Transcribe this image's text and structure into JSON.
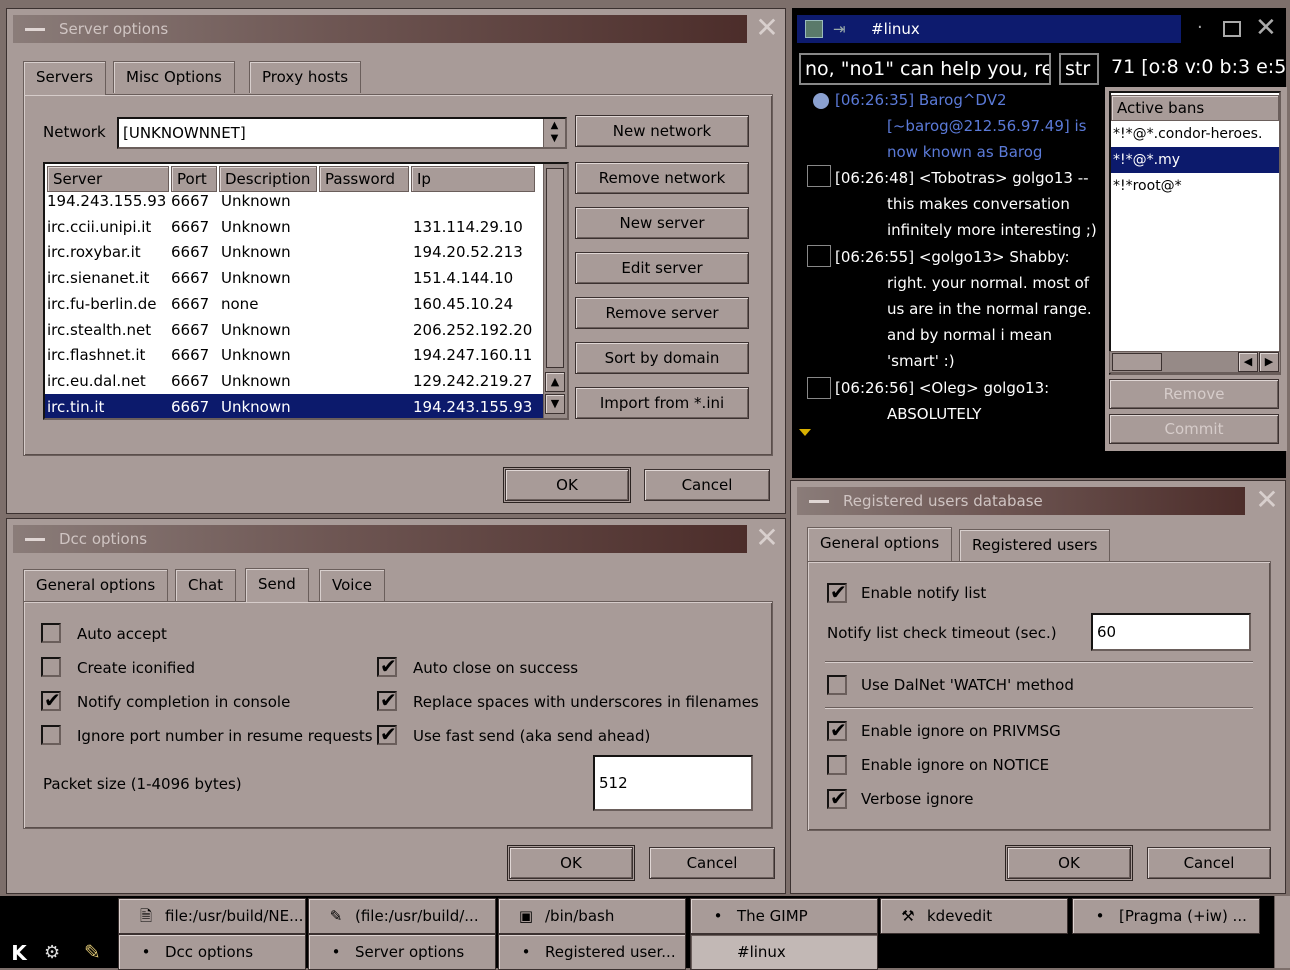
{
  "server_options": {
    "title": "Server options",
    "tabs": [
      "Servers",
      "Misc Options",
      "Proxy hosts"
    ],
    "network_label": "Network",
    "network_value": "[UNKNOWNNET]",
    "columns": [
      "Server",
      "Port",
      "Description",
      "Password",
      "Ip"
    ],
    "rows": [
      {
        "server": "194.243.155.93",
        "port": "6667",
        "desc": "Unknown",
        "ip": ""
      },
      {
        "server": "irc.ccii.unipi.it",
        "port": "6667",
        "desc": "Unknown",
        "ip": "131.114.29.10"
      },
      {
        "server": "irc.roxybar.it",
        "port": "6667",
        "desc": "Unknown",
        "ip": "194.20.52.213"
      },
      {
        "server": "irc.sienanet.it",
        "port": "6667",
        "desc": "Unknown",
        "ip": "151.4.144.10"
      },
      {
        "server": "irc.fu-berlin.de",
        "port": "6667",
        "desc": "none",
        "ip": "160.45.10.24"
      },
      {
        "server": "irc.stealth.net",
        "port": "6667",
        "desc": "Unknown",
        "ip": "206.252.192.20"
      },
      {
        "server": "irc.flashnet.it",
        "port": "6667",
        "desc": "Unknown",
        "ip": "194.247.160.11"
      },
      {
        "server": "irc.eu.dal.net",
        "port": "6667",
        "desc": "Unknown",
        "ip": "129.242.219.27"
      },
      {
        "server": "irc.tin.it",
        "port": "6667",
        "desc": "Unknown",
        "ip": "194.243.155.93"
      }
    ],
    "buttons": [
      "New network",
      "Remove network",
      "New server",
      "Edit server",
      "Remove server",
      "Sort by domain",
      "Import from *.ini"
    ],
    "ok": "OK",
    "cancel": "Cancel"
  },
  "irc": {
    "title": "#linux",
    "topic": "no, \"no1\" can help you, re",
    "topic2": "str",
    "modes": "71 [o:8 v:0 b:3 e:5",
    "messages": [
      {
        "l1": "[06:26:35] Barog^DV2",
        "l2": "[~barog@212.56.97.49] is",
        "l3": "now known as Barog"
      },
      {
        "l1": "[06:26:48] <Tobotras> golgo13 --",
        "l2": "this makes conversation",
        "l3": "infinitely more interesting ;)"
      },
      {
        "l1": "[06:26:55] <golgo13> Shabby:",
        "l2": "right. your normal. most of",
        "l3": "us are in the normal range.",
        "l4": "and by normal i mean",
        "l5": "'smart' :)"
      },
      {
        "l1": "[06:26:56] <Oleg> golgo13:",
        "l2": "ABSOLUTELY"
      }
    ],
    "bans_header": "Active bans",
    "bans": [
      "*!*@*.condor-heroes.",
      "*!*@*.my",
      "*!*root@*"
    ],
    "remove": "Remove",
    "commit": "Commit"
  },
  "dcc": {
    "title": "Dcc options",
    "tabs": [
      "General options",
      "Chat",
      "Send",
      "Voice"
    ],
    "auto_accept": "Auto accept",
    "create_iconified": "Create iconified",
    "notify_completion": "Notify completion in console",
    "ignore_port": "Ignore port number in resume requests",
    "auto_close": "Auto close on success",
    "replace_spaces": "Replace spaces with underscores in filenames",
    "fast_send": "Use fast send (aka send ahead)",
    "packet_label": "Packet size (1-4096 bytes)",
    "packet_value": "512",
    "ok": "OK",
    "cancel": "Cancel"
  },
  "reg": {
    "title": "Registered users database",
    "tabs": [
      "General options",
      "Registered users"
    ],
    "enable_notify": "Enable notify list",
    "timeout_label": "Notify list check timeout (sec.)",
    "timeout_value": "60",
    "dalnet_watch": "Use DalNet 'WATCH' method",
    "ignore_privmsg": "Enable ignore on PRIVMSG",
    "ignore_notice": "Enable ignore on NOTICE",
    "verbose_ignore": "Verbose ignore",
    "ok": "OK",
    "cancel": "Cancel"
  },
  "taskbar": {
    "row1": [
      "file:/usr/build/NE...",
      "(file:/usr/build/...",
      "/bin/bash",
      "The GIMP",
      "kdevedit",
      "[Pragma (+iw) ..."
    ],
    "row2": [
      "Dcc options",
      "Server options",
      "Registered user...",
      "#linux"
    ]
  }
}
